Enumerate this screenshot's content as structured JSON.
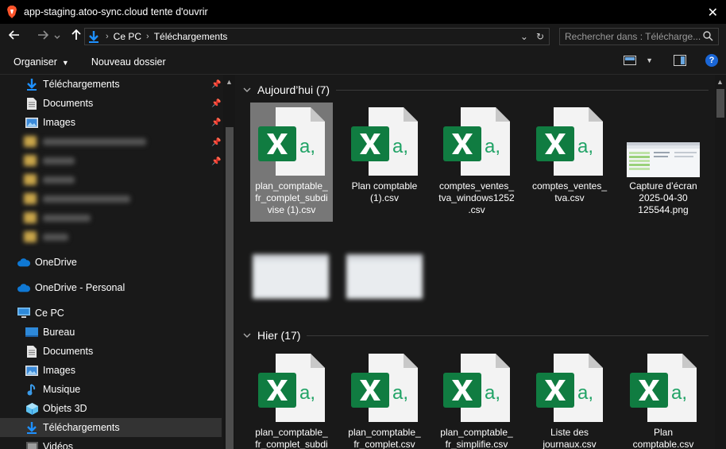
{
  "window": {
    "title": "app-staging.atoo-sync.cloud tente d'ouvrir",
    "close_glyph": "✕"
  },
  "address": {
    "root_label": "Ce PC",
    "folder_label": "Téléchargements",
    "separator": "›",
    "history_glyph": "⌄",
    "refresh_glyph": "↻"
  },
  "search": {
    "placeholder": "Rechercher dans : Télécharge..."
  },
  "commands": {
    "organize_label": "Organiser",
    "new_folder_label": "Nouveau dossier",
    "help_label": "?"
  },
  "sidebar": {
    "quick_access": [
      {
        "label": "Téléchargements",
        "icon": "download-arrow-icon"
      },
      {
        "label": "Documents",
        "icon": "document-icon"
      },
      {
        "label": "Images",
        "icon": "picture-icon"
      }
    ],
    "onedrive_label": "OneDrive",
    "onedrive_personal_label": "OneDrive - Personal",
    "this_pc_label": "Ce PC",
    "this_pc_items": [
      {
        "label": "Bureau",
        "icon": "desktop-icon"
      },
      {
        "label": "Documents",
        "icon": "document-icon"
      },
      {
        "label": "Images",
        "icon": "picture-icon"
      },
      {
        "label": "Musique",
        "icon": "music-note-icon"
      },
      {
        "label": "Objets 3D",
        "icon": "cube-3d-icon"
      },
      {
        "label": "Téléchargements",
        "icon": "download-arrow-icon"
      },
      {
        "label": "Vidéos",
        "icon": "video-icon"
      }
    ]
  },
  "groups": {
    "today": {
      "title": "Aujourd’hui (7)",
      "files": [
        {
          "name": "plan_comptable_ fr_complet_subdi vise (1).csv",
          "type": "excel-csv"
        },
        {
          "name": "Plan comptable (1).csv",
          "type": "excel-csv"
        },
        {
          "name": "comptes_ventes_ tva_windows1252 .csv",
          "type": "excel-csv"
        },
        {
          "name": "comptes_ventes_ tva.csv",
          "type": "excel-csv"
        },
        {
          "name": "Capture d’écran 2025-04-30 125544.png",
          "type": "screenshot-png"
        }
      ]
    },
    "yesterday": {
      "title": "Hier (17)",
      "files": [
        {
          "name": "plan_comptable_ fr_complet_subdi",
          "type": "excel-csv"
        },
        {
          "name": "plan_comptable_ fr_complet.csv",
          "type": "excel-csv"
        },
        {
          "name": "plan_comptable_ fr_simplifie.csv",
          "type": "excel-csv"
        },
        {
          "name": "Liste des journaux.csv",
          "type": "excel-csv"
        },
        {
          "name": "Plan comptable.csv",
          "type": "excel-csv"
        }
      ]
    }
  },
  "colors": {
    "excel_green": "#107c41",
    "folder_blue": "#1e90ff",
    "onedrive_blue": "#0f78d4",
    "help_blue": "#1a66d6"
  }
}
